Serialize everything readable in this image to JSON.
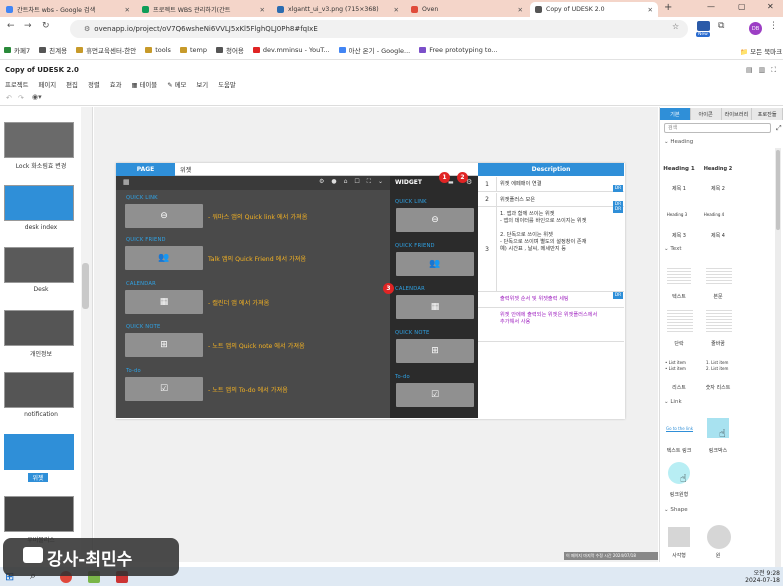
{
  "browser": {
    "tabs": [
      {
        "title": "간트차트 wbs - Google 검색",
        "color": "#4285f4"
      },
      {
        "title": "프로젝트 WBS 관리하기(간트",
        "color": "#0f9d58"
      },
      {
        "title": "xlgantt_ui_v3.png (715×368)",
        "color": "#2b6cb0"
      },
      {
        "title": "Oven",
        "color": "#e04b3a"
      },
      {
        "title": "Copy of UDESK 2.0",
        "color": "#555555"
      }
    ],
    "new_tab": "+",
    "url": "ovenapp.io/project/oV7Q6wsheNi6VVLJ5xKl5FlghQLJ0Ph8#fqIxE",
    "profile": "DB",
    "new_badge": "New",
    "bookmarks": [
      "카페7",
      "친계용",
      "휴먼교육센터-한안",
      "tools",
      "temp",
      "청어용",
      "dev.mminsu - YouT...",
      "아산 온기 - Google...",
      "Free prototyping to..."
    ],
    "bookmarks_right": "모든 북마크"
  },
  "app": {
    "title": "Copy of UDESK 2.0",
    "menu": [
      "프로젝트",
      "페이지",
      "편집",
      "정렬",
      "효과",
      "테이블",
      "메모",
      "보기",
      "도움말"
    ],
    "menu_prefix_icons": [
      "",
      "",
      "",
      "",
      "",
      "▦",
      "✎",
      "",
      ""
    ]
  },
  "pages": [
    {
      "label": "Lock 화소림효 변경"
    },
    {
      "label": "desk index"
    },
    {
      "label": "Desk"
    },
    {
      "label": "개인정보"
    },
    {
      "label": "notification"
    },
    {
      "label": "위젯"
    },
    {
      "label": "우비물리스"
    }
  ],
  "canvas": {
    "page_tab": "PAGE",
    "page_name": "위젯",
    "widget_title": "WIDGET",
    "sections": [
      {
        "title": "QUICK LINK",
        "desc": "- 워마스 앱의 Quick link 에서 가져옴",
        "icon": "link-icon"
      },
      {
        "title": "QUICK FRIEND",
        "desc": "Talk 앱의 Quick Friend 에서 가져옴",
        "icon": "people-icon"
      },
      {
        "title": "CALENDAR",
        "desc": "- 캘린더 앱 에서 가져옴",
        "icon": "calendar-icon"
      },
      {
        "title": "QUICK NOTE",
        "desc": "- 노트 앱의 Quick note 에서 가져옴",
        "icon": "note-add-icon"
      },
      {
        "title": "To-do",
        "desc": "- 노트 앱의 To-do 에서 가져옴",
        "icon": "checkbox-icon"
      }
    ],
    "widget_sections": [
      "QUICK LINK",
      "QUICK FRIEND",
      "CALENDAR",
      "QUICK NOTE",
      "To-do"
    ],
    "badges": [
      "1",
      "2",
      "3"
    ]
  },
  "description": {
    "header": "Description",
    "rows": [
      {
        "num": "1",
        "text": "위젯 에페매이 연결"
      },
      {
        "num": "2",
        "text": "위젯플러스 모은"
      },
      {
        "num": "3",
        "text": "1. 앱과 함께 쓰이는 위젯\n- 앱의 데이터를 바인으로 쓰이지는 위젯\n\n2. 단독으로 쓰이는 위젯\n- 단독으로 쓰이며 별도의 설정창이 존재\n예) 시간표 , 날씨, 메세만지 등"
      },
      {
        "num": "",
        "text": "출력위젯 순서 및 위젯출력 세팅"
      },
      {
        "num": "",
        "text": "위젯 안에에 출력되는 위젯은 위젯플러스에서\n추가해서 사용"
      }
    ],
    "btn": "DR"
  },
  "rightpanel": {
    "tabs": [
      "기본",
      "아이콘",
      "라이브러리",
      "포로잔들"
    ],
    "search_placeholder": "검색",
    "sections": [
      "Heading",
      "Text",
      "Link",
      "Shape"
    ],
    "heading_items": [
      "Heading 1",
      "Heading 2",
      "제목 1",
      "제목 2",
      "Heading 3",
      "Heading 4",
      "제목 3",
      "제목 4"
    ],
    "text_items": [
      "텍스트",
      "본문",
      "단락",
      "줄바꿈",
      "리스트",
      "숫자 리스트"
    ],
    "link_items": [
      "텍스트 링크",
      "링크박스",
      "링크원형"
    ],
    "shape_items": [
      "사각형",
      "원"
    ],
    "status": "이 페이지 마지막 수정 시간 2024/07/18"
  },
  "taskbar": {
    "time": "오전 9:28",
    "date": "2024-07-18",
    "caption": "강사-최민수"
  }
}
